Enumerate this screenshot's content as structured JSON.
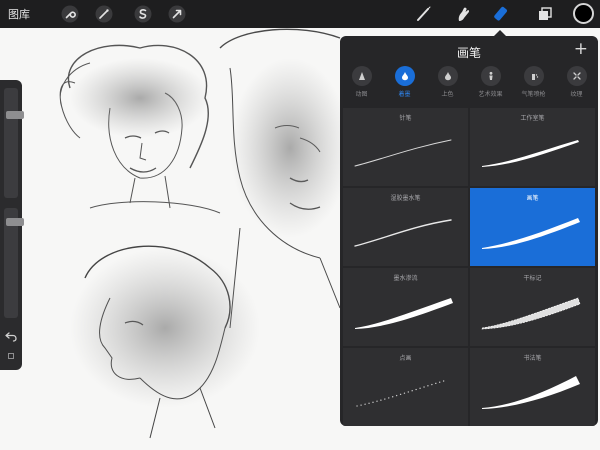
{
  "toolbar": {
    "gallery_label": "图库",
    "left_tools": [
      {
        "name": "wrench-icon"
      },
      {
        "name": "adjustments-wand-icon"
      },
      {
        "name": "selection-s-icon"
      },
      {
        "name": "transform-arrow-icon"
      }
    ],
    "right_tools": [
      {
        "name": "brush-icon",
        "active": false
      },
      {
        "name": "smudge-icon",
        "active": false
      },
      {
        "name": "eraser-icon",
        "active": true
      },
      {
        "name": "layers-icon",
        "active": false
      }
    ],
    "current_color": "#000000",
    "active_color": "#1a6ed8"
  },
  "sidebar": {
    "size_slider_value": 0.77,
    "opacity_slider_value": 0.9,
    "undo_icon": "undo-icon",
    "modify_icon": "square-icon"
  },
  "brush_panel": {
    "title": "画笔",
    "add_label": "+",
    "categories": [
      {
        "label": "动图",
        "icon": "sketch-cone-icon",
        "active": false
      },
      {
        "label": "着墨",
        "icon": "ink-drop-icon",
        "active": true
      },
      {
        "label": "上色",
        "icon": "paint-drop-icon",
        "active": false
      },
      {
        "label": "艺术效果",
        "icon": "art-figure-icon",
        "active": false
      },
      {
        "label": "气笔喷枪",
        "icon": "airbrush-icon",
        "active": false
      },
      {
        "label": "纹理",
        "icon": "texture-icon",
        "active": false
      }
    ],
    "brushes": [
      {
        "name": "针笔",
        "selected": false
      },
      {
        "name": "工作室笔",
        "selected": false
      },
      {
        "name": "湿胶墨水笔",
        "selected": false
      },
      {
        "name": "画笔",
        "selected": true
      },
      {
        "name": "墨水渗流",
        "selected": false
      },
      {
        "name": "干标记",
        "selected": false
      },
      {
        "name": "点画",
        "selected": false
      },
      {
        "name": "书法笔",
        "selected": false
      }
    ]
  }
}
